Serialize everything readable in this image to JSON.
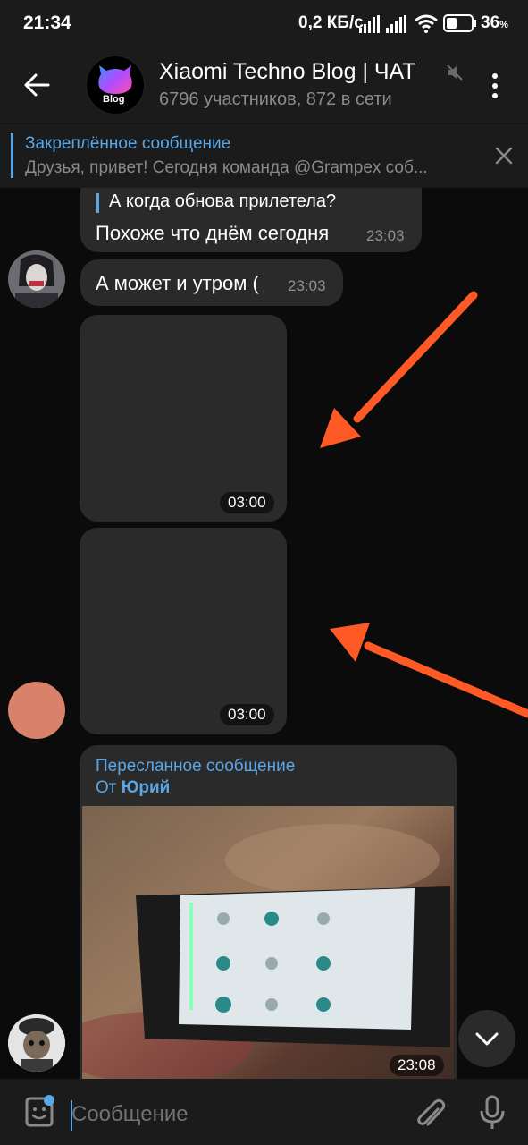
{
  "status_bar": {
    "time": "21:34",
    "network_speed": "0,2 КБ/с",
    "battery_percent": "36",
    "battery_suffix": "%"
  },
  "header": {
    "title": "Xiaomi Techno Blog | ЧАТ",
    "subtitle": "6796 участников, 872 в сети",
    "avatar_text": "Blog"
  },
  "pinned": {
    "title": "Закреплённое сообщение",
    "text": "Друзья, привет! Сегодня команда @Grampex соб..."
  },
  "messages": {
    "m1": {
      "reply_quote": "А когда обнова прилетела?",
      "text": "Похоже что днём сегодня",
      "time": "23:03"
    },
    "m2": {
      "text": "А может и утром (",
      "time": "23:03"
    },
    "video1": {
      "duration": "03:00"
    },
    "video2": {
      "duration": "03:00"
    },
    "forward": {
      "label": "Пересланное сообщение",
      "from_prefix": "От",
      "from_name": "Юрий",
      "time": "23:08"
    }
  },
  "composer": {
    "placeholder": "Сообщение"
  },
  "colors": {
    "accent": "#5aa6e6",
    "arrow": "#ff5a26",
    "bubble": "#2a2a2a",
    "background": "#0b0b0b"
  }
}
